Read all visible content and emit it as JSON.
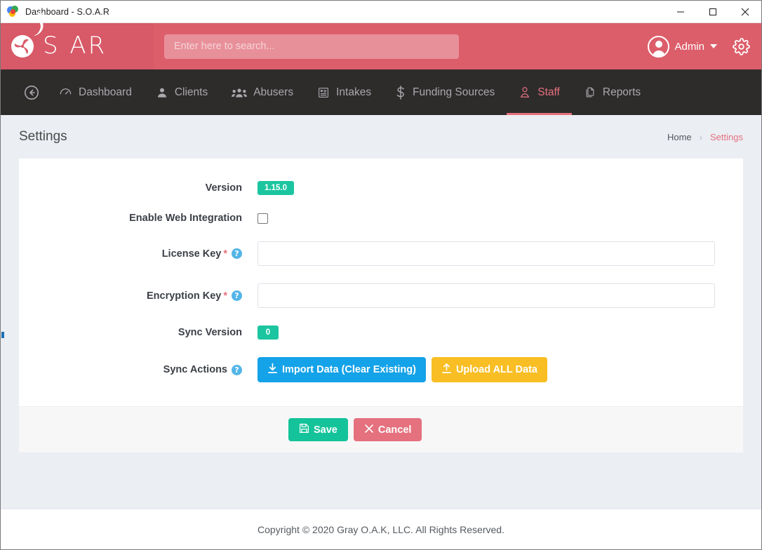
{
  "window": {
    "title": "Dashboard - S.O.A.R",
    "favicon": "soar-favicon",
    "minimize_label": "Minimize",
    "maximize_label": "Maximize",
    "close_label": "Close"
  },
  "header": {
    "logo_text": "S  AR",
    "logo_mark": "pinwheel-icon",
    "bird_icon": "bird-icon",
    "search": {
      "placeholder": "Enter here to search...",
      "value": ""
    },
    "user": {
      "name": "Admin",
      "avatar": "user-avatar-icon",
      "caret": "chevron-down-icon"
    },
    "settings_icon": "gear-icon"
  },
  "nav": {
    "back_icon": "back-arrow-icon",
    "items": [
      {
        "label": "Dashboard",
        "icon": "dashboard-icon",
        "active": false
      },
      {
        "label": "Clients",
        "icon": "user-icon",
        "active": false
      },
      {
        "label": "Abusers",
        "icon": "users-icon",
        "active": false
      },
      {
        "label": "Intakes",
        "icon": "form-icon",
        "active": false
      },
      {
        "label": "Funding Sources",
        "icon": "dollar-icon",
        "active": false
      },
      {
        "label": "Staff",
        "icon": "staff-icon",
        "active": true
      },
      {
        "label": "Reports",
        "icon": "documents-icon",
        "active": false
      }
    ]
  },
  "page": {
    "title": "Settings",
    "breadcrumb": {
      "home": "Home",
      "separator": "›",
      "current": "Settings"
    }
  },
  "form": {
    "rows": {
      "version": {
        "label": "Version",
        "value": "1.15.0"
      },
      "web_integration": {
        "label": "Enable Web Integration",
        "checked": false
      },
      "license_key": {
        "label": "License Key",
        "required_marker": "*",
        "help": "?",
        "value": "",
        "placeholder": ""
      },
      "encryption_key": {
        "label": "Encryption Key",
        "required_marker": "*",
        "help": "?",
        "value": "",
        "placeholder": ""
      },
      "sync_version": {
        "label": "Sync Version",
        "value": "0"
      },
      "sync_actions": {
        "label": "Sync Actions",
        "help": "?",
        "import_button": "Import Data (Clear Existing)",
        "import_icon": "download-icon",
        "upload_button": "Upload ALL Data",
        "upload_icon": "upload-icon"
      }
    },
    "footer": {
      "save_label": "Save",
      "save_icon": "floppy-disk-icon",
      "cancel_label": "Cancel",
      "cancel_icon": "close-x-icon"
    }
  },
  "footer": {
    "copyright": "Copyright © 2020 Gray O.A.K, LLC. All Rights Reserved."
  },
  "colors": {
    "brand_pink": "#DD5E6B",
    "nav_dark": "#2E2B2B",
    "page_bg": "#EBEEF3",
    "accent_green": "#1BC5A0",
    "accent_blue": "#14A2E8",
    "accent_yellow": "#F8BE24",
    "help_blue": "#53B5E8"
  }
}
